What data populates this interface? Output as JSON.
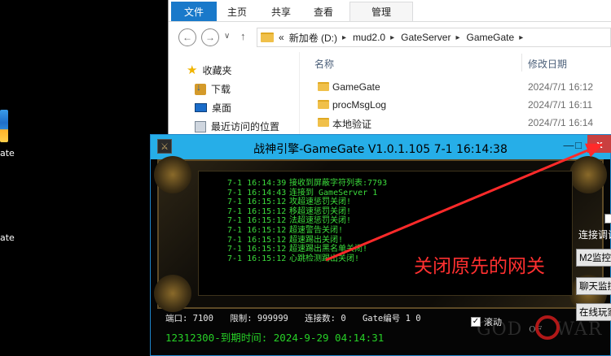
{
  "desktop": {
    "icons": [
      {
        "label": "ate"
      },
      {
        "label": "ate"
      }
    ]
  },
  "explorer": {
    "ribbon_tabs": {
      "file": "文件",
      "home": "主页",
      "share": "共享",
      "view": "查看",
      "manage": "管理"
    },
    "nav_buttons": {
      "back": "←",
      "forward": "→",
      "dropdown": "∨",
      "up": "↑"
    },
    "address": {
      "overflow": "«",
      "segments": [
        "新加卷 (D:)",
        "mud2.0",
        "GateServer",
        "GameGate"
      ]
    },
    "nav_pane": [
      {
        "label": "收藏夹",
        "icon": "star-icon"
      },
      {
        "label": "下载",
        "icon": "download-folder-icon"
      },
      {
        "label": "桌面",
        "icon": "desktop-icon"
      },
      {
        "label": "最近访问的位置",
        "icon": "recent-places-icon"
      }
    ],
    "columns": {
      "name": "名称",
      "date": "修改日期"
    },
    "files": [
      {
        "name": "GameGate",
        "date": "2024/7/1 16:12"
      },
      {
        "name": "procMsgLog",
        "date": "2024/7/1 16:11"
      },
      {
        "name": "本地验证",
        "date": "2024/7/1 16:14"
      }
    ]
  },
  "gamegate": {
    "title": "战神引擎-GameGate V1.0.1.105 7-1 16:14:38",
    "window_buttons": {
      "minimize": "—",
      "maximize": "□",
      "close": "x"
    },
    "log": [
      {
        "time": "7-1 16:14:39",
        "msg": "接收到屏蔽字符列表:7793"
      },
      {
        "time": "7-1 16:14:43",
        "msg": "连接到 GameServer 1"
      },
      {
        "time": "7-1 16:15:12",
        "msg": "攻超速惩罚关闭!"
      },
      {
        "time": "7-1 16:15:12",
        "msg": "移超速惩罚关闭!"
      },
      {
        "time": "7-1 16:15:12",
        "msg": "法超速惩罚关闭!"
      },
      {
        "time": "7-1 16:15:12",
        "msg": "超速警告关闭!"
      },
      {
        "time": "7-1 16:15:12",
        "msg": "超速踢出关闭!"
      },
      {
        "time": "7-1 16:15:12",
        "msg": "超速踢出黑名单关闭!"
      },
      {
        "time": "7-1 16:15:12",
        "msg": "心跳检测踢出关闭!"
      }
    ],
    "status": {
      "port": "端口: 7100",
      "limit": "限制: 999999",
      "connections": "连接数: 0",
      "gate_no": "Gate编号 1 0"
    },
    "scroll_label": "滚动",
    "scroll_checked": true,
    "expire": "12312300-到期时间: 2024-9-29 04:14:31",
    "logo": {
      "left": "GOD",
      "mid": "OF",
      "right": "WAR"
    }
  },
  "side_panel": {
    "label": "连接调试",
    "buttons": [
      "M2监控",
      "聊天监控",
      "在线玩家"
    ]
  },
  "annotation": {
    "text": "关闭原先的网关",
    "color": "#ff3030"
  }
}
